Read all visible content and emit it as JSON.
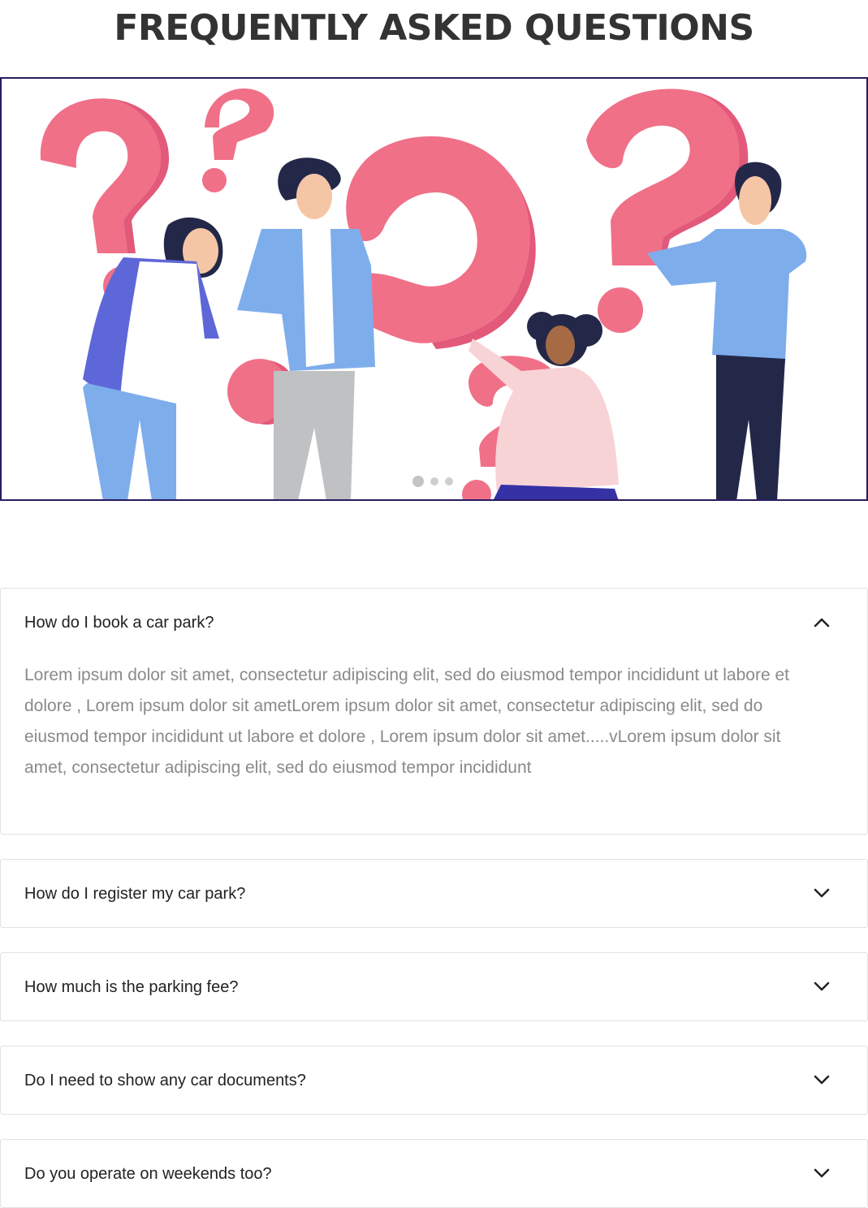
{
  "page": {
    "title": "FREQUENTLY ASKED QUESTIONS"
  },
  "hero": {
    "image_icon": "people-with-question-marks-illustration",
    "slide_count": 3,
    "active_slide": 1
  },
  "colors": {
    "accent_pink": "#f07088",
    "border_purple": "#2a1a5e",
    "answer_text": "#8a8a8a"
  },
  "faq": {
    "items": [
      {
        "question": "How do I book a car park?",
        "expanded": true,
        "chevron_icon": "chevron-up-icon",
        "answer": "Lorem ipsum dolor sit amet, consectetur adipiscing elit, sed do eiusmod tempor incididunt ut labore et dolore , Lorem ipsum dolor sit ametLorem ipsum dolor sit amet, consectetur adipiscing elit, sed do eiusmod tempor incididunt ut labore et dolore , Lorem ipsum dolor sit amet.....vLorem ipsum dolor sit amet, consectetur adipiscing elit, sed do eiusmod tempor incididunt"
      },
      {
        "question": "How do I register my car park?",
        "expanded": false,
        "chevron_icon": "chevron-down-icon"
      },
      {
        "question": "How much is the parking fee?",
        "expanded": false,
        "chevron_icon": "chevron-down-icon"
      },
      {
        "question": "Do I need to show any car documents?",
        "expanded": false,
        "chevron_icon": "chevron-down-icon"
      },
      {
        "question": "Do you operate on weekends too?",
        "expanded": false,
        "chevron_icon": "chevron-down-icon"
      }
    ]
  }
}
